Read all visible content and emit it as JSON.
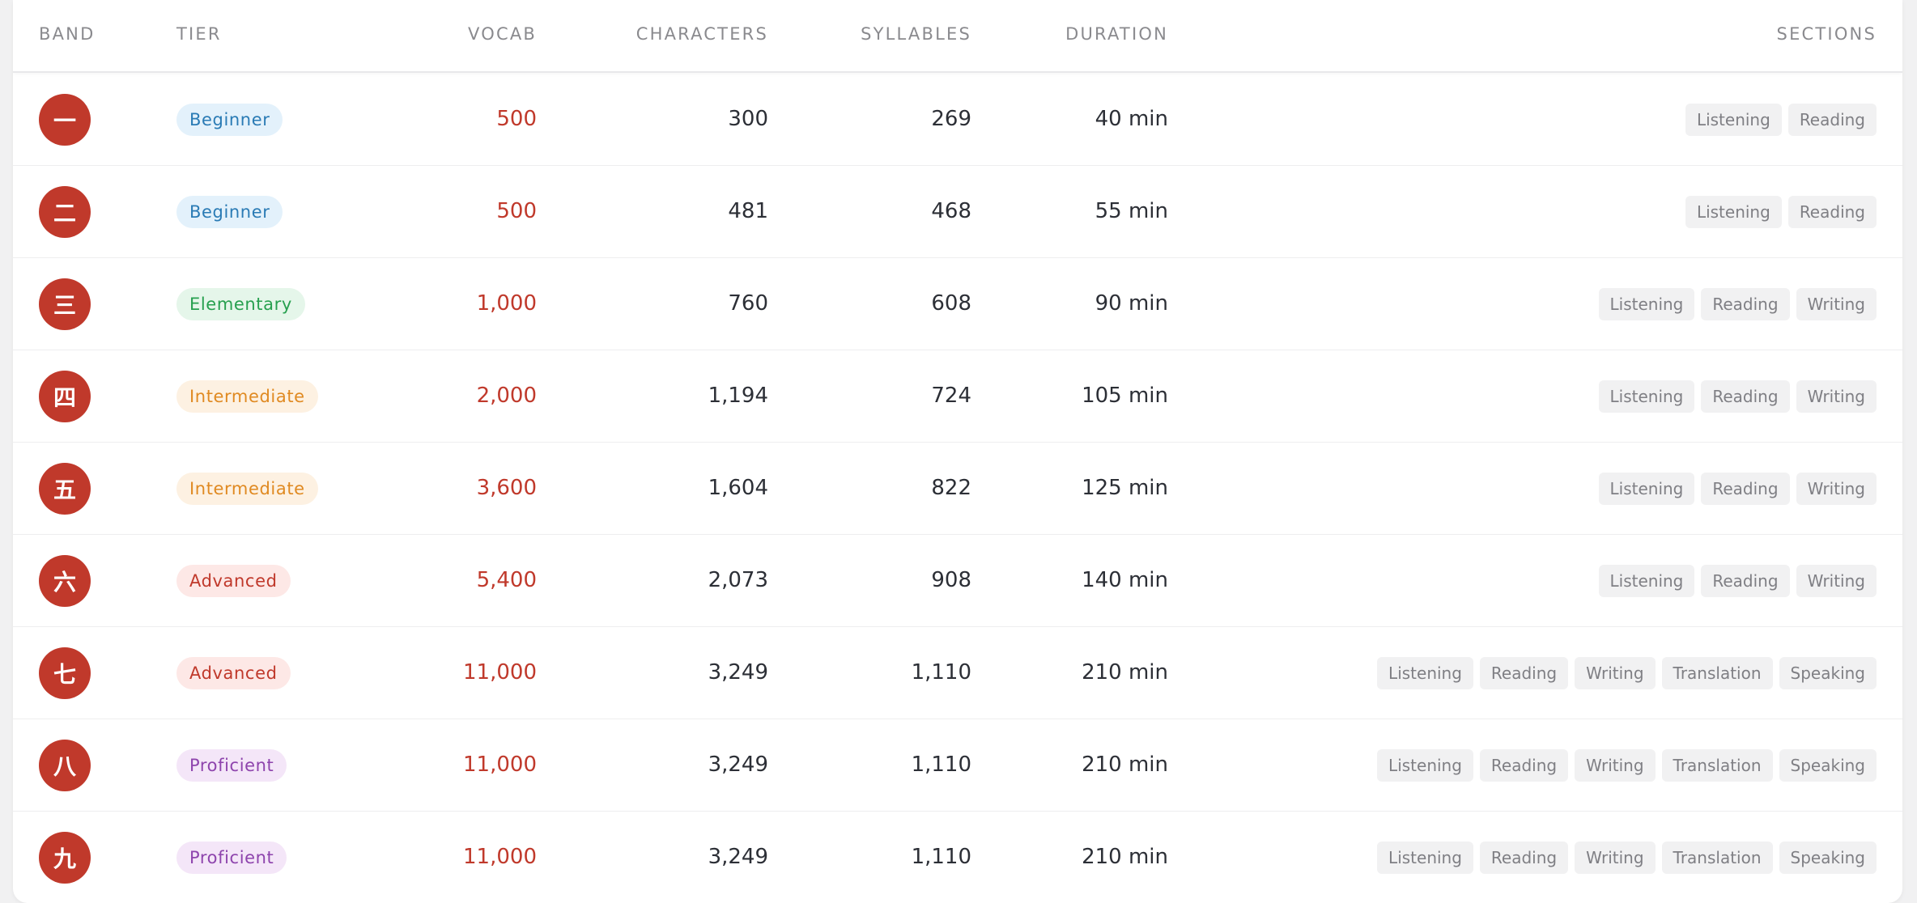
{
  "columns": {
    "band": "BAND",
    "tier": "TIER",
    "vocab": "VOCAB",
    "characters": "CHARACTERS",
    "syllables": "SYLLABLES",
    "duration": "DURATION",
    "sections": "SECTIONS"
  },
  "tier_colors": {
    "Beginner": "#2a7bb5",
    "Elementary": "#27a04f",
    "Intermediate": "#e08a22",
    "Advanced": "#c0392b",
    "Proficient": "#8e44ad"
  },
  "band_color": "#c0392b",
  "rows": [
    {
      "band": "一",
      "tier": "Beginner",
      "vocab": "500",
      "characters": "300",
      "syllables": "269",
      "duration": "40 min",
      "sections": [
        "Listening",
        "Reading"
      ]
    },
    {
      "band": "二",
      "tier": "Beginner",
      "vocab": "500",
      "characters": "481",
      "syllables": "468",
      "duration": "55 min",
      "sections": [
        "Listening",
        "Reading"
      ]
    },
    {
      "band": "三",
      "tier": "Elementary",
      "vocab": "1,000",
      "characters": "760",
      "syllables": "608",
      "duration": "90 min",
      "sections": [
        "Listening",
        "Reading",
        "Writing"
      ]
    },
    {
      "band": "四",
      "tier": "Intermediate",
      "vocab": "2,000",
      "characters": "1,194",
      "syllables": "724",
      "duration": "105 min",
      "sections": [
        "Listening",
        "Reading",
        "Writing"
      ]
    },
    {
      "band": "五",
      "tier": "Intermediate",
      "vocab": "3,600",
      "characters": "1,604",
      "syllables": "822",
      "duration": "125 min",
      "sections": [
        "Listening",
        "Reading",
        "Writing"
      ]
    },
    {
      "band": "六",
      "tier": "Advanced",
      "vocab": "5,400",
      "characters": "2,073",
      "syllables": "908",
      "duration": "140 min",
      "sections": [
        "Listening",
        "Reading",
        "Writing"
      ]
    },
    {
      "band": "七",
      "tier": "Advanced",
      "vocab": "11,000",
      "characters": "3,249",
      "syllables": "1,110",
      "duration": "210 min",
      "sections": [
        "Listening",
        "Reading",
        "Writing",
        "Translation",
        "Speaking"
      ]
    },
    {
      "band": "八",
      "tier": "Proficient",
      "vocab": "11,000",
      "characters": "3,249",
      "syllables": "1,110",
      "duration": "210 min",
      "sections": [
        "Listening",
        "Reading",
        "Writing",
        "Translation",
        "Speaking"
      ]
    },
    {
      "band": "九",
      "tier": "Proficient",
      "vocab": "11,000",
      "characters": "3,249",
      "syllables": "1,110",
      "duration": "210 min",
      "sections": [
        "Listening",
        "Reading",
        "Writing",
        "Translation",
        "Speaking"
      ]
    }
  ]
}
